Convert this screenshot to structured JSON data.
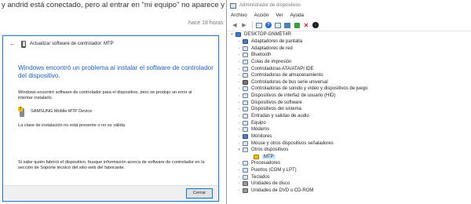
{
  "forum": {
    "text": "y andrid está conectado, pero al entrar en \"mi equipo\" no aparece y no puedo acceder a el.",
    "time": "hace 18 horas"
  },
  "dialog": {
    "title": "Actualizar software de controlador: MTP",
    "heading": "Windows encontró un problema al instalar el software de controlador del dispositivo.",
    "description": "Windows encontró software de controlador para el dispositivo, pero se produjo un error al intentar instalarlo.",
    "device_name": "SAMSUNG Mobile MTP Device",
    "class_error": "La clase de instalación no está presente o no es válida.",
    "footer_text": "Si sabe quién fabricó el dispositivo, busque información acerca de software de controlador en la sección de Soporte técnico del sitio web del fabricante.",
    "cancel_label": "Cerrar",
    "icons": {
      "back": "back-arrow-icon",
      "device": "mtp-device-icon",
      "warning": "warning-icon"
    }
  },
  "devmgr": {
    "title": "Administrador de dispositivos",
    "menu": [
      "Archivo",
      "Acción",
      "Ver",
      "Ayuda"
    ],
    "toolbar_icons": [
      "back-arrow-icon",
      "forward-arrow-icon",
      "properties-icon",
      "help-icon",
      "scan-hardware-icon",
      "monitor-icon",
      "update-driver-icon",
      "uninstall-icon",
      "disable-icon"
    ],
    "tree": {
      "root": "DESKTOP-GNMET4R",
      "items": [
        {
          "label": "Adaptadores de pantalla",
          "icon": "display-adapter-icon"
        },
        {
          "label": "Adaptadores de red",
          "icon": "network-adapter-icon"
        },
        {
          "label": "Bluetooth",
          "icon": "bluetooth-icon"
        },
        {
          "label": "Colas de impresión",
          "icon": "printer-queue-icon"
        },
        {
          "label": "Controladoras ATA/ATAPI IDE",
          "icon": "ide-controller-icon"
        },
        {
          "label": "Controladoras de almacenamiento",
          "icon": "storage-controller-icon"
        },
        {
          "label": "Controladoras de bus serie universal",
          "icon": "usb-controller-icon"
        },
        {
          "label": "Controladoras de sonido y vídeo y dispositivos de juego",
          "icon": "sound-icon"
        },
        {
          "label": "Dispositivos de interfaz de usuario (HID)",
          "icon": "hid-icon"
        },
        {
          "label": "Dispositivos de software",
          "icon": "software-device-icon"
        },
        {
          "label": "Dispositivos del sistema",
          "icon": "system-device-icon"
        },
        {
          "label": "Entradas y salidas de audio",
          "icon": "audio-io-icon"
        },
        {
          "label": "Equipo",
          "icon": "computer-icon"
        },
        {
          "label": "Módems",
          "icon": "modem-icon"
        },
        {
          "label": "Monitores",
          "icon": "monitor-icon"
        },
        {
          "label": "Mouse y otros dispositivos señaladores",
          "icon": "mouse-icon"
        },
        {
          "label": "Otros dispositivos",
          "icon": "other-devices-icon",
          "expanded": true
        },
        {
          "label": "MTP",
          "icon": "warning-device-icon",
          "child": true,
          "selected": true
        },
        {
          "label": "Procesadores",
          "icon": "processor-icon"
        },
        {
          "label": "Puertos (COM y LPT)",
          "icon": "port-icon"
        },
        {
          "label": "Teclados",
          "icon": "keyboard-icon"
        },
        {
          "label": "Unidades de disco",
          "icon": "disk-drive-icon"
        },
        {
          "label": "Unidades de DVD o CD-ROM",
          "icon": "dvd-drive-icon"
        }
      ]
    }
  }
}
